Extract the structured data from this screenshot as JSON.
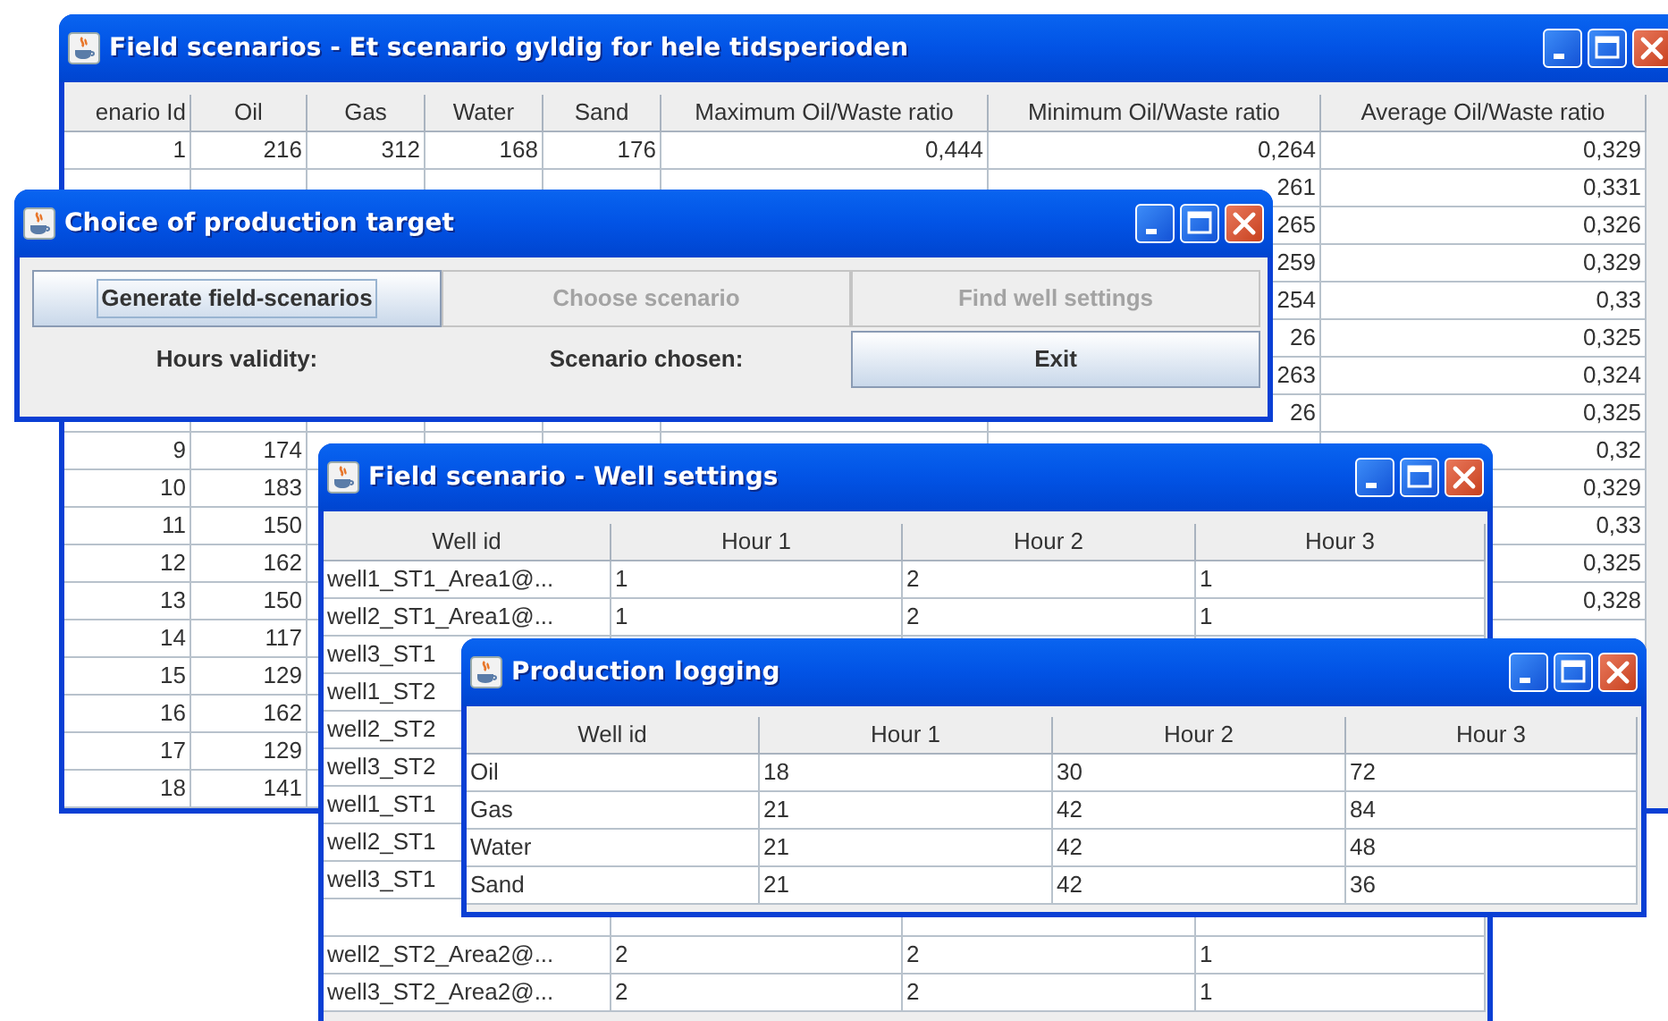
{
  "field_scenarios_window": {
    "title": "Field scenarios - Et scenario gyldig for hele tidsperioden",
    "columns": [
      "enario Id",
      "Oil",
      "Gas",
      "Water",
      "Sand",
      "Maximum Oil/Waste ratio",
      "Minimum Oil/Waste ratio",
      "Average Oil/Waste ratio"
    ],
    "rows": [
      {
        "scenario_id": "1",
        "oil": "216",
        "gas": "312",
        "water": "168",
        "sand": "176",
        "max_ratio": "0,444",
        "min_ratio": "0,264",
        "avg_ratio": "0,329"
      },
      {
        "min_ratio": "261",
        "avg_ratio": "0,331"
      },
      {
        "min_ratio": "265",
        "avg_ratio": "0,326"
      },
      {
        "min_ratio": "259",
        "avg_ratio": "0,329"
      },
      {
        "min_ratio": "254",
        "avg_ratio": "0,33"
      },
      {
        "min_ratio": "26",
        "avg_ratio": "0,325"
      },
      {
        "min_ratio": "263",
        "avg_ratio": "0,324"
      },
      {
        "min_ratio": "26",
        "avg_ratio": "0,325"
      },
      {
        "scenario_id": "9",
        "oil": "174",
        "avg_ratio": "0,32"
      },
      {
        "scenario_id": "10",
        "oil": "183",
        "avg_ratio": "0,329"
      },
      {
        "scenario_id": "11",
        "oil": "150",
        "avg_ratio": "0,33"
      },
      {
        "scenario_id": "12",
        "oil": "162",
        "avg_ratio": "0,325"
      },
      {
        "scenario_id": "13",
        "oil": "150",
        "avg_ratio": "0,328"
      },
      {
        "scenario_id": "14",
        "oil": "117"
      },
      {
        "scenario_id": "15",
        "oil": "129"
      },
      {
        "scenario_id": "16",
        "oil": "162"
      },
      {
        "scenario_id": "17",
        "oil": "129"
      },
      {
        "scenario_id": "18",
        "oil": "141"
      }
    ]
  },
  "choice_dialog": {
    "title": "Choice of production target",
    "cells": [
      {
        "kind": "button",
        "label": "Generate field-scenarios",
        "disabled": false,
        "focused": true
      },
      {
        "kind": "button",
        "label": "Choose scenario",
        "disabled": true,
        "focused": false
      },
      {
        "kind": "button",
        "label": "Find well settings",
        "disabled": true,
        "focused": false
      },
      {
        "kind": "label",
        "label": "Hours validity:"
      },
      {
        "kind": "label",
        "label": "Scenario chosen:"
      },
      {
        "kind": "button",
        "label": "Exit",
        "disabled": false,
        "focused": false
      }
    ]
  },
  "well_settings_window": {
    "title": "Field scenario - Well settings",
    "columns": [
      "Well id",
      "Hour 1",
      "Hour 2",
      "Hour 3"
    ],
    "rows": [
      [
        "well1_ST1_Area1@...",
        "1",
        "2",
        "1"
      ],
      [
        "well2_ST1_Area1@...",
        "1",
        "2",
        "1"
      ],
      [
        "well3_ST1"
      ],
      [
        "well1_ST2"
      ],
      [
        "well2_ST2"
      ],
      [
        "well3_ST2"
      ],
      [
        "well1_ST1"
      ],
      [
        "well2_ST1"
      ],
      [
        "well3_ST1"
      ],
      [],
      [
        "well2_ST2_Area2@...",
        "2",
        "2",
        "1"
      ],
      [
        "well3_ST2_Area2@...",
        "2",
        "2",
        "1"
      ]
    ]
  },
  "production_logging_window": {
    "title": "Production logging",
    "columns": [
      "Well id",
      "Hour 1",
      "Hour 2",
      "Hour 3"
    ],
    "rows": [
      [
        "Oil",
        "18",
        "30",
        "72"
      ],
      [
        "Gas",
        "21",
        "42",
        "84"
      ],
      [
        "Water",
        "21",
        "42",
        "48"
      ],
      [
        "Sand",
        "21",
        "42",
        "36"
      ]
    ]
  }
}
